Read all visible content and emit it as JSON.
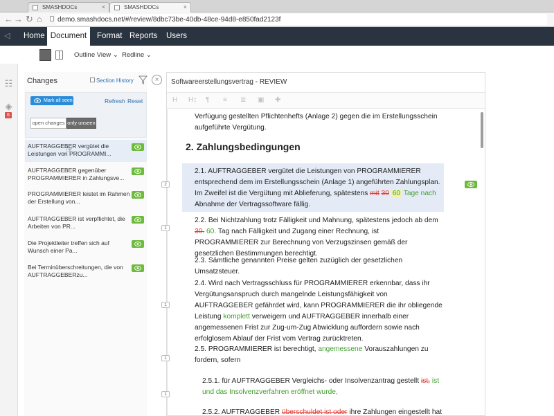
{
  "browser": {
    "tabs": [
      {
        "label": "SMASHDOCs",
        "active": false
      },
      {
        "label": "SMASHDOCs",
        "active": true
      }
    ],
    "url": "demo.smashdocs.net/#/review/8dbc73be-40db-48ce-94d8-e850fad2123f"
  },
  "nav": {
    "items": [
      "Home",
      "Document",
      "Format",
      "Reports",
      "Users"
    ],
    "active": "Document"
  },
  "subbar": {
    "outline_view": "Outline View",
    "redline": "Redline"
  },
  "rail": {
    "badge": "6"
  },
  "changes": {
    "title": "Changes",
    "section_history": "Section History",
    "mark_all_seen": "Mark all seen",
    "refresh": "Refresh",
    "reset": "Reset",
    "open_changes": "open changes",
    "only_unseen": "only unseen",
    "items": [
      "AUFTRAGGEBER vergütet die Leistungen von PROGRAMMI...",
      "AUFTRAGGEBER gegenüber PROGRAMMIERER in Zahlungsve...",
      "PROGRAMMIERER leistet im Rahmen der Erstellung von...",
      "AUFTRAGGEBER ist verpflichtet, die Arbeiten von PR...",
      "Die Projektleiter treffen sich auf Wunsch einer Pa...",
      "Bei Terminüberschreitungen, die von AUFTRAGGEBERzu..."
    ]
  },
  "document": {
    "title": "Softwareerstellungsvertrag - REVIEW",
    "toolbar": [
      "H",
      "H↕",
      "¶",
      "≡",
      "≣",
      "▣",
      "✚"
    ],
    "markers": [
      "2",
      "1",
      "1",
      "1",
      "1"
    ],
    "intro": "Verfügung gestellten Pflichtenhefts (Anlage 2) gegen die im Erstellungsschein aufgeführte Vergütung.",
    "heading": "2.  Zahlungsbedingungen",
    "p21": {
      "text_a": "2.1.  AUFTRAGGEBER vergütet die Leistungen von PROGRAMMIERER entsprechend dem im Erstellungsschein (Anlage 1) angeführten Zahlungsplan. Im Zweifel ist die Vergütung mit Ablieferung, spätestens ",
      "del_a": "mit",
      "del_b": "30",
      "hl": "60",
      "ins": "Tage nach",
      "text_b": " Abnahme der Vertragssoftware fällig."
    },
    "p22": {
      "text_a": "2.2.  Bei Nichtzahlung trotz Fälligkeit und Mahnung, spätestens jedoch ab dem ",
      "del": "30.",
      "ins": "60.",
      "text_b": " Tag nach Fälligkeit und Zugang einer Rechnung, ist PROGRAMMIERER zur Berechnung von Verzugszinsen gemäß der gesetzlichen Bestimmungen berechtigt."
    },
    "p23": "2.3.  Sämtliche genannten Preise gelten zuzüglich der gesetzlichen Umsatzsteuer.",
    "p24": {
      "text_a": "2.4.  Wird nach Vertragsschluss für PROGRAMMIERER erkennbar, dass ihr Vergütungsanspruch durch mangelnde Leistungsfähigkeit von AUFTRAGGEBER gefährdet wird, kann PROGRAMMIERER die ihr obliegende Leistung ",
      "ins": "komplett",
      "text_b": " verweigern und AUFTRAGGEBER innerhalb einer angemessenen Frist zur Zug-um-Zug Abwicklung auffordern sowie nach erfolglosem Ablauf der Frist vom Vertrag zurücktreten."
    },
    "p25": {
      "text_a": "2.5.  PROGRAMMIERER ist berechtigt, ",
      "ins": "angemessene",
      "text_b": " Vorauszahlungen zu fordern, sofern"
    },
    "p251": {
      "text_a": "2.5.1.  für AUFTRAGGEBER Vergleichs- oder Insolvenzantrag gestellt ",
      "del": "ist,",
      "ins": " ist und das Insolvenzverfahren eröffnet wurde,"
    },
    "p252": {
      "text_a": "2.5.2.  AUFTRAGGEBER ",
      "del": "überschuldet ist oder",
      "text_b": " ihre Zahlungen eingestellt hat"
    }
  }
}
